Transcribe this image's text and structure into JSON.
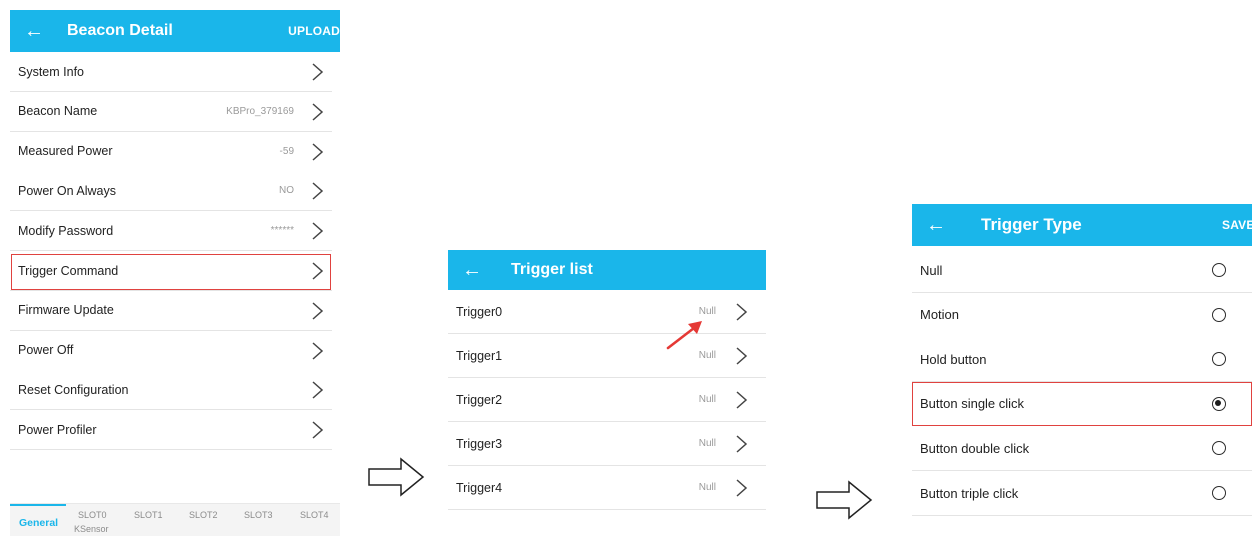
{
  "beacon_detail": {
    "title": "Beacon Detail",
    "action": "UPLOAD",
    "rows": [
      {
        "label": "System Info",
        "value": ""
      },
      {
        "label": "Beacon Name",
        "value": "KBPro_379169"
      },
      {
        "label": "Measured Power",
        "value": "-59"
      },
      {
        "label": "Power On Always",
        "value": "NO"
      },
      {
        "label": "Modify Password",
        "value": "******"
      },
      {
        "label": "Trigger Command",
        "value": ""
      },
      {
        "label": "Firmware Update",
        "value": ""
      },
      {
        "label": "Power Off",
        "value": ""
      },
      {
        "label": "Reset Configuration",
        "value": ""
      },
      {
        "label": "Power Profiler",
        "value": ""
      }
    ],
    "tabs": [
      "General",
      "SLOT0",
      "SLOT1",
      "SLOT2",
      "SLOT3",
      "SLOT4"
    ],
    "tab_sub": "KSensor"
  },
  "trigger_list": {
    "title": "Trigger list",
    "rows": [
      {
        "label": "Trigger0",
        "value": "Null"
      },
      {
        "label": "Trigger1",
        "value": "Null"
      },
      {
        "label": "Trigger2",
        "value": "Null"
      },
      {
        "label": "Trigger3",
        "value": "Null"
      },
      {
        "label": "Trigger4",
        "value": "Null"
      }
    ]
  },
  "trigger_type": {
    "title": "Trigger Type",
    "action": "SAVE",
    "options": [
      {
        "label": "Null",
        "checked": false
      },
      {
        "label": "Motion",
        "checked": false
      },
      {
        "label": "Hold button",
        "checked": false
      },
      {
        "label": "Button single click",
        "checked": true
      },
      {
        "label": "Button double click",
        "checked": false
      },
      {
        "label": "Button triple click",
        "checked": false
      }
    ]
  },
  "icons": {
    "back": "arrow-left-icon",
    "row_nav": "chevron-right-icon",
    "flow": "outline-arrow-right-icon",
    "pointer": "red-pointer-arrow-icon"
  },
  "colors": {
    "appbar": "#1ab6ea",
    "highlight": "#e0423f",
    "pointer": "#e53935"
  }
}
